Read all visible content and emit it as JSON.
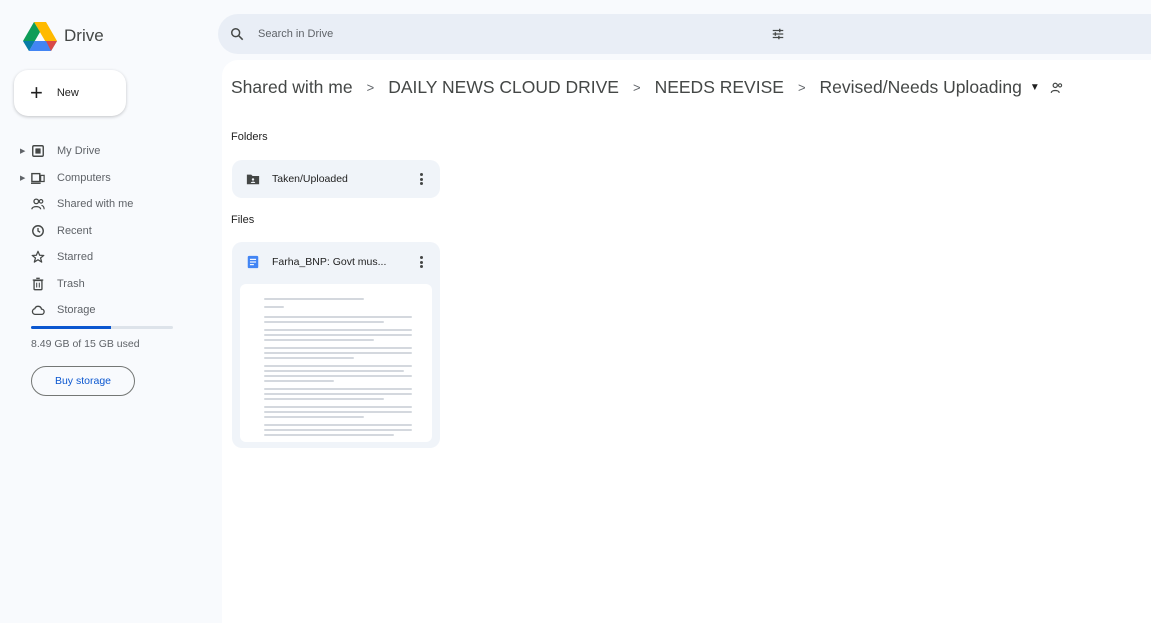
{
  "app": {
    "name": "Drive"
  },
  "sidebar": {
    "new_label": "New",
    "items": [
      {
        "label": "My Drive",
        "icon": "my-drive-icon",
        "expandable": true
      },
      {
        "label": "Computers",
        "icon": "computers-icon",
        "expandable": true
      },
      {
        "label": "Shared with me",
        "icon": "shared-with-me-icon",
        "expandable": false
      },
      {
        "label": "Recent",
        "icon": "recent-icon",
        "expandable": false
      },
      {
        "label": "Starred",
        "icon": "star-icon",
        "expandable": false
      },
      {
        "label": "Trash",
        "icon": "trash-icon",
        "expandable": false
      },
      {
        "label": "Storage",
        "icon": "cloud-icon",
        "expandable": false
      }
    ],
    "storage": {
      "used_text": "8.49 GB of 15 GB used",
      "used_fraction": 0.566
    },
    "buy_storage_label": "Buy storage"
  },
  "search": {
    "placeholder": "Search in Drive"
  },
  "breadcrumb": [
    "Shared with me",
    "DAILY NEWS CLOUD DRIVE",
    "NEEDS REVISE",
    "Revised/Needs Uploading"
  ],
  "sections": {
    "folders_title": "Folders",
    "files_title": "Files"
  },
  "folders": [
    {
      "name": "Taken/Uploaded"
    }
  ],
  "files": [
    {
      "name": "Farha_BNP: Govt mus..."
    }
  ],
  "colors": {
    "accent": "#0b57d0",
    "surface": "#f0f4f9",
    "background": "#f8fafd"
  }
}
